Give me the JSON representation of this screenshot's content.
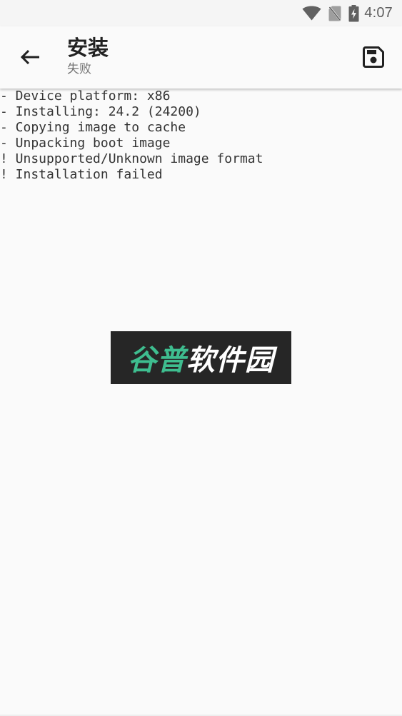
{
  "status_bar": {
    "time": "4:07",
    "icons": [
      "wifi-icon",
      "no-sim-icon",
      "battery-charging-icon"
    ]
  },
  "app_bar": {
    "back_icon": "arrow-back-icon",
    "title": "安装",
    "subtitle": "失败",
    "save_icon": "save-icon"
  },
  "console": {
    "lines": [
      "- Device platform: x86",
      "- Installing: 24.2 (24200)",
      "- Copying image to cache",
      "- Unpacking boot image",
      "! Unsupported/Unknown image format",
      "! Installation failed"
    ]
  },
  "watermark": {
    "part1": "谷普",
    "part2": "软件园"
  }
}
